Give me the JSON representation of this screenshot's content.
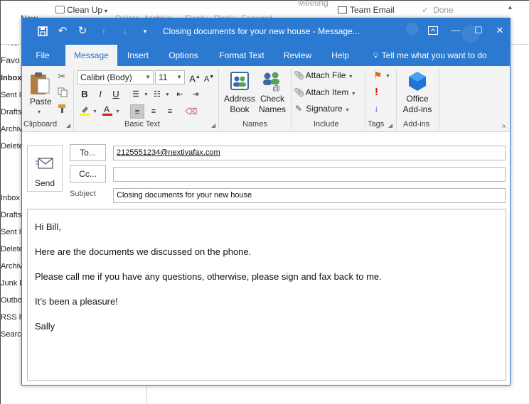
{
  "background": {
    "toolbar": {
      "new_label": "New",
      "clean_up_label": "Clean Up",
      "delete_label": "Delete",
      "archive_label": "Archive",
      "reply_label": "Reply",
      "reply_all_label": "Reply",
      "forward_label": "Forward",
      "meeting_label": "Meeting",
      "team_email_label": "Team Email",
      "done_label": "Done"
    },
    "folder_pane": {
      "truncated_top": [
        "ew",
        "ail",
        "Ne"
      ],
      "favorites_label": "Favo",
      "items": [
        "Inbox",
        "Sent I",
        "Drafts",
        "Archiv",
        "Delete",
        "Inbox",
        "Drafts",
        "Sent I",
        "Delete",
        "Archiv",
        "Junk E",
        "Outbo",
        "RSS Fe",
        "Search"
      ]
    }
  },
  "window": {
    "title": "Closing documents for your new house  -  Message...",
    "quick_access": {
      "save_icon": "save-icon",
      "undo_icon": "undo-icon",
      "redo_icon": "redo-icon",
      "up_icon": "arrow-up-icon",
      "down_icon": "arrow-down-icon",
      "customize_icon": "customize-icon"
    },
    "tabs": [
      {
        "label": "File"
      },
      {
        "label": "Message"
      },
      {
        "label": "Insert"
      },
      {
        "label": "Options"
      },
      {
        "label": "Format Text"
      },
      {
        "label": "Review"
      },
      {
        "label": "Help"
      }
    ],
    "tell_me": "Tell me what you want to do",
    "ribbon": {
      "clipboard": {
        "label": "Clipboard",
        "paste_label": "Paste"
      },
      "basic_text": {
        "label": "Basic Text",
        "font": "Calibri (Body)",
        "size": "11"
      },
      "names": {
        "label": "Names",
        "address_book_line1": "Address",
        "address_book_line2": "Book",
        "check_names_line1": "Check",
        "check_names_line2": "Names"
      },
      "include": {
        "label": "Include",
        "attach_file": "Attach File",
        "attach_item": "Attach Item",
        "signature": "Signature"
      },
      "tags": {
        "label": "Tags"
      },
      "addins": {
        "label": "Add-ins",
        "office_addins_line1": "Office",
        "office_addins_line2": "Add-ins"
      }
    },
    "compose": {
      "send_label": "Send",
      "to_label": "To...",
      "cc_label": "Cc...",
      "subject_label": "Subject",
      "to_value": "2125551234@nextivafax.com",
      "cc_value": "",
      "subject_value": "Closing documents for your new house",
      "body_lines": [
        "Hi Bill,",
        "Here are the documents we discussed on the phone.",
        "Please call me if you have any questions, otherwise, please sign and fax back to me.",
        "It’s been a pleasure!",
        "Sally"
      ]
    }
  }
}
